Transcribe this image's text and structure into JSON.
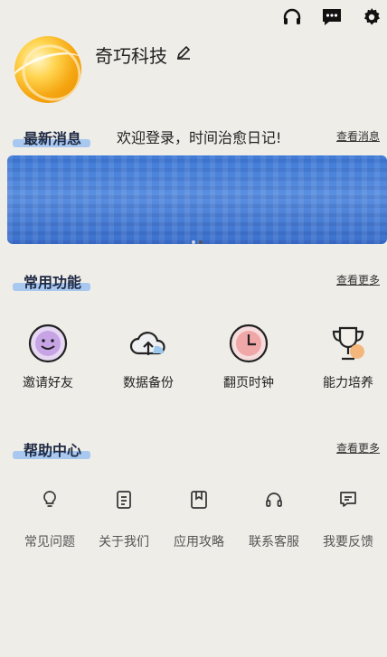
{
  "header": {
    "icons": [
      "headset-icon",
      "chat-icon",
      "gear-icon"
    ]
  },
  "profile": {
    "username": "奇巧科技"
  },
  "news": {
    "title": "最新消息",
    "message": "欢迎登录，时间治愈日记!",
    "more_label": "查看消息"
  },
  "banner": {
    "slide_index": 2,
    "slide_count": 2
  },
  "features": {
    "title": "常用功能",
    "more_label": "查看更多",
    "items": [
      {
        "label": "邀请好友",
        "icon": "smiley-icon"
      },
      {
        "label": "数据备份",
        "icon": "cloud-upload-icon"
      },
      {
        "label": "翻页时钟",
        "icon": "clock-icon"
      },
      {
        "label": "能力培养",
        "icon": "trophy-icon"
      }
    ]
  },
  "help": {
    "title": "帮助中心",
    "more_label": "查看更多",
    "items": [
      {
        "label": "常见问题",
        "icon": "lightbulb-icon"
      },
      {
        "label": "关于我们",
        "icon": "document-icon"
      },
      {
        "label": "应用攻略",
        "icon": "bookmark-icon"
      },
      {
        "label": "联系客服",
        "icon": "headset-icon"
      },
      {
        "label": "我要反馈",
        "icon": "feedback-icon"
      }
    ]
  },
  "colors": {
    "background": "#efede8",
    "highlight": "#a8c8f0",
    "banner_blue": "#3f7ad6"
  }
}
